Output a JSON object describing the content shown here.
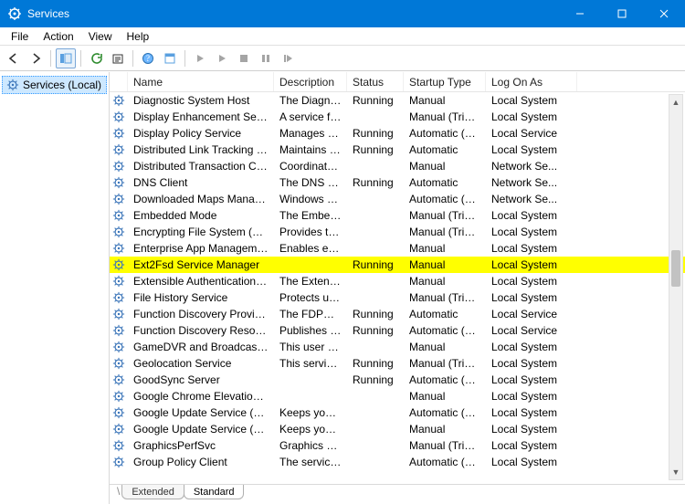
{
  "window": {
    "title": "Services"
  },
  "menu": {
    "file": "File",
    "action": "Action",
    "view": "View",
    "help": "Help"
  },
  "tree": {
    "root": "Services (Local)"
  },
  "columns": {
    "name": "Name",
    "description": "Description",
    "status": "Status",
    "startup": "Startup Type",
    "logon": "Log On As"
  },
  "tabs": {
    "extended": "Extended",
    "standard": "Standard"
  },
  "rows": [
    {
      "name": "Diagnostic System Host",
      "desc": "The Diagnos...",
      "status": "Running",
      "startup": "Manual",
      "logon": "Local System"
    },
    {
      "name": "Display Enhancement Service",
      "desc": "A service for ...",
      "status": "",
      "startup": "Manual (Trigg...",
      "logon": "Local System"
    },
    {
      "name": "Display Policy Service",
      "desc": "Manages th...",
      "status": "Running",
      "startup": "Automatic (De...",
      "logon": "Local Service"
    },
    {
      "name": "Distributed Link Tracking Cli...",
      "desc": "Maintains li...",
      "status": "Running",
      "startup": "Automatic",
      "logon": "Local System"
    },
    {
      "name": "Distributed Transaction Coor...",
      "desc": "Coordinates ...",
      "status": "",
      "startup": "Manual",
      "logon": "Network Se..."
    },
    {
      "name": "DNS Client",
      "desc": "The DNS Cli...",
      "status": "Running",
      "startup": "Automatic",
      "logon": "Network Se..."
    },
    {
      "name": "Downloaded Maps Manager",
      "desc": "Windows ser...",
      "status": "",
      "startup": "Automatic (De...",
      "logon": "Network Se..."
    },
    {
      "name": "Embedded Mode",
      "desc": "The Embedd...",
      "status": "",
      "startup": "Manual (Trigg...",
      "logon": "Local System"
    },
    {
      "name": "Encrypting File System (EFS)",
      "desc": "Provides the...",
      "status": "",
      "startup": "Manual (Trigg...",
      "logon": "Local System"
    },
    {
      "name": "Enterprise App Manageme...",
      "desc": "Enables ente...",
      "status": "",
      "startup": "Manual",
      "logon": "Local System"
    },
    {
      "name": "Ext2Fsd Service Manager",
      "desc": "",
      "status": "Running",
      "startup": "Manual",
      "logon": "Local System",
      "highlight": true
    },
    {
      "name": "Extensible Authentication Pr...",
      "desc": "The Extensib...",
      "status": "",
      "startup": "Manual",
      "logon": "Local System"
    },
    {
      "name": "File History Service",
      "desc": "Protects user...",
      "status": "",
      "startup": "Manual (Trigg...",
      "logon": "Local System"
    },
    {
      "name": "Function Discovery Provider ...",
      "desc": "The FDPHOS...",
      "status": "Running",
      "startup": "Automatic",
      "logon": "Local Service"
    },
    {
      "name": "Function Discovery Resourc...",
      "desc": "Publishes thi...",
      "status": "Running",
      "startup": "Automatic (Tri...",
      "logon": "Local Service"
    },
    {
      "name": "GameDVR and Broadcast Us...",
      "desc": "This user ser...",
      "status": "",
      "startup": "Manual",
      "logon": "Local System"
    },
    {
      "name": "Geolocation Service",
      "desc": "This service ...",
      "status": "Running",
      "startup": "Manual (Trigg...",
      "logon": "Local System"
    },
    {
      "name": "GoodSync Server",
      "desc": "",
      "status": "Running",
      "startup": "Automatic (De...",
      "logon": "Local System"
    },
    {
      "name": "Google Chrome Elevation Se...",
      "desc": "",
      "status": "",
      "startup": "Manual",
      "logon": "Local System"
    },
    {
      "name": "Google Update Service (gup...",
      "desc": "Keeps your ...",
      "status": "",
      "startup": "Automatic (De...",
      "logon": "Local System"
    },
    {
      "name": "Google Update Service (gup...",
      "desc": "Keeps your ...",
      "status": "",
      "startup": "Manual",
      "logon": "Local System"
    },
    {
      "name": "GraphicsPerfSvc",
      "desc": "Graphics per...",
      "status": "",
      "startup": "Manual (Trigg...",
      "logon": "Local System"
    },
    {
      "name": "Group Policy Client",
      "desc": "The service i...",
      "status": "",
      "startup": "Automatic (Tri...",
      "logon": "Local System"
    }
  ]
}
